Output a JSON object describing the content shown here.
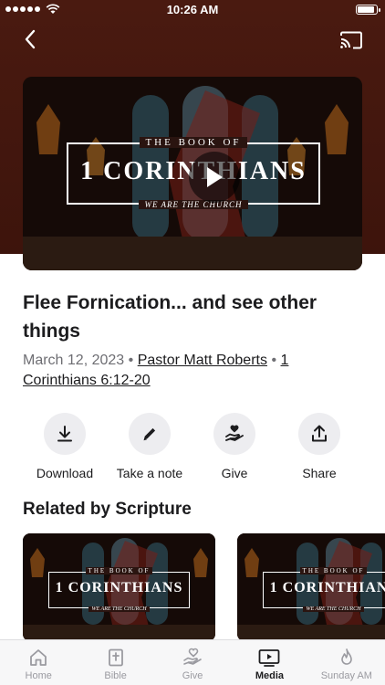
{
  "status_bar": {
    "time": "10:26 AM"
  },
  "video": {
    "series_top": "THE BOOK OF",
    "series_main": "1 CORINTHIANS",
    "series_sub": "WE ARE THE CHURCH"
  },
  "sermon": {
    "title": "Flee Fornication... and see other things",
    "date": "March 12, 2023",
    "separator": "•",
    "speaker": "Pastor Matt Roberts",
    "scripture": "1 Corinthians 6:12-20"
  },
  "actions": [
    {
      "label": "Download",
      "icon": "download-icon"
    },
    {
      "label": "Take a note",
      "icon": "pencil-icon"
    },
    {
      "label": "Give",
      "icon": "give-icon"
    },
    {
      "label": "Share",
      "icon": "share-icon"
    }
  ],
  "related": {
    "heading": "Related by Scripture",
    "cards": [
      {
        "top": "THE BOOK OF",
        "main": "1 CORINTHIANS",
        "sub": "WE ARE THE CHURCH"
      },
      {
        "top": "THE BOOK OF",
        "main": "1 CORINTHIANS",
        "sub": "WE ARE THE CHURCH"
      }
    ]
  },
  "tabs": [
    {
      "label": "Home",
      "icon": "home-icon",
      "active": false
    },
    {
      "label": "Bible",
      "icon": "bible-icon",
      "active": false
    },
    {
      "label": "Give",
      "icon": "give-icon",
      "active": false
    },
    {
      "label": "Media",
      "icon": "media-icon",
      "active": true
    },
    {
      "label": "Sunday AM",
      "icon": "flame-icon",
      "active": false
    }
  ],
  "colors": {
    "hero_background": "#4a1a10",
    "tab_active": "#1c1c1e",
    "tab_inactive": "#9a9aa0"
  }
}
